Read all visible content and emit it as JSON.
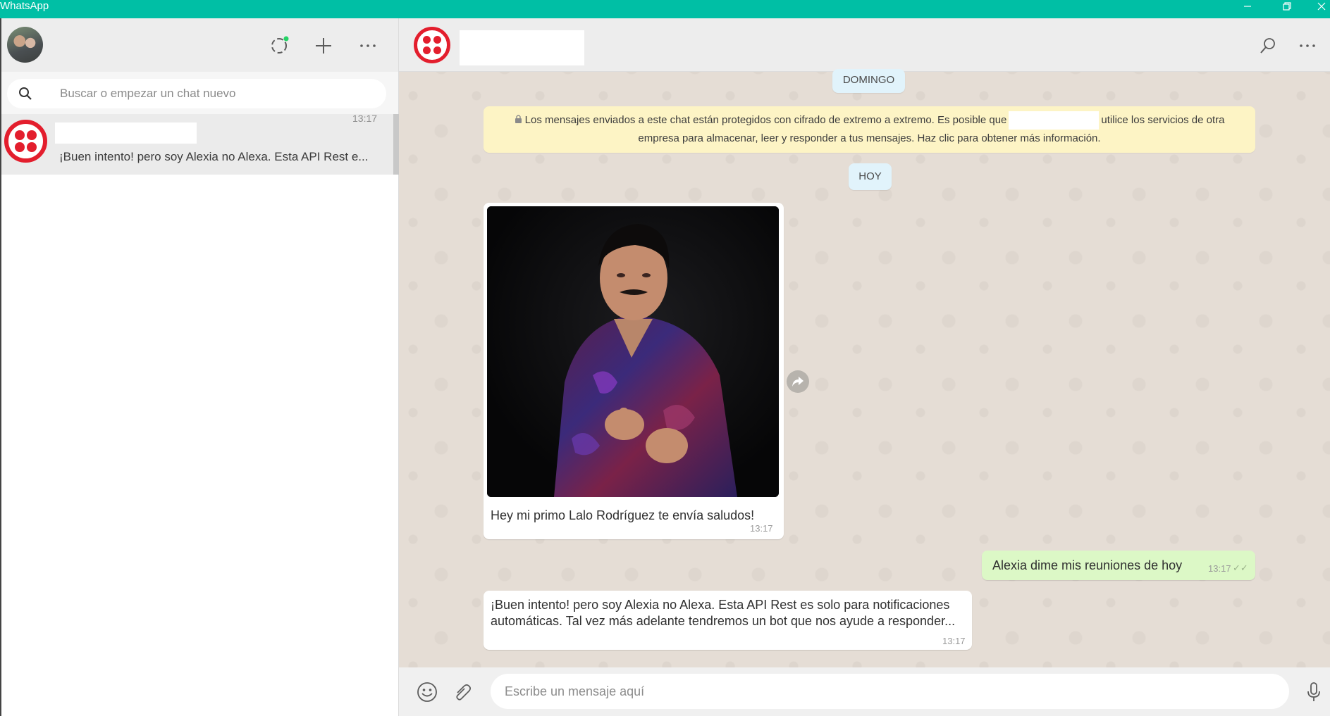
{
  "window": {
    "title": "WhatsApp",
    "controls": [
      "minimize-icon",
      "restore-icon",
      "close-icon"
    ]
  },
  "colors": {
    "titlebar": "#00bfa5",
    "twilio_red": "#e31e2d",
    "chat_bg": "#e5ddd5",
    "outgoing_bubble": "#dcf8c6",
    "notice_bg": "#fdf4c5",
    "status_dot": "#25d366"
  },
  "sidebar": {
    "header_icons": [
      "status-icon",
      "new-chat-icon",
      "menu-icon"
    ],
    "search": {
      "placeholder": "Buscar o empezar un chat nuevo"
    },
    "chats": [
      {
        "time": "13:17",
        "preview": "¡Buen intento! pero soy Alexia no Alexa. Esta API Rest e..."
      }
    ]
  },
  "conversation": {
    "header_icons": [
      "search-icon",
      "menu-icon"
    ],
    "date_labels": {
      "sunday": "DOMINGO",
      "today": "HOY"
    },
    "encryption_notice": {
      "part1": "Los mensajes enviados a este chat están protegidos con cifrado de extremo a extremo. Es posible que",
      "part2": "utilice los servicios de otra empresa para almacenar, leer y responder a tus mensajes. Haz clic para obtener más información."
    },
    "messages": [
      {
        "direction": "incoming",
        "has_image": true,
        "text": "Hey mi primo Lalo Rodríguez te envía saludos!",
        "time": "13:17"
      },
      {
        "direction": "outgoing",
        "text": "Alexia dime mis reuniones de hoy",
        "time": "13:17",
        "ticks": "✓✓"
      },
      {
        "direction": "incoming",
        "text_line1": "¡Buen intento! pero soy Alexia no Alexa. Esta API Rest es solo para notificaciones",
        "text_line2": "automáticas. Tal vez más adelante tendremos un bot que nos ayude a responder...",
        "time": "13:17"
      }
    ]
  },
  "composer": {
    "placeholder": "Escribe un mensaje aquí",
    "icons": [
      "emoji-icon",
      "attach-icon",
      "mic-icon"
    ]
  }
}
